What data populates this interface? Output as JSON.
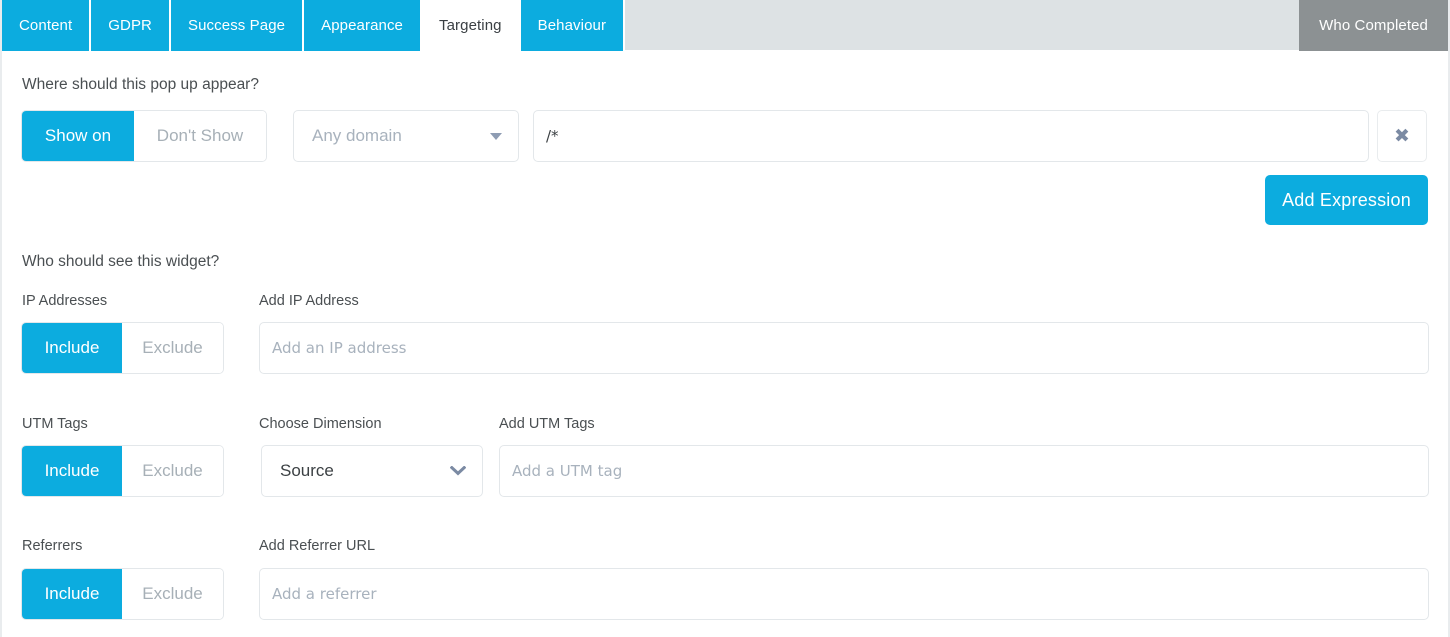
{
  "tabs": [
    {
      "label": "Content",
      "active": false
    },
    {
      "label": "GDPR",
      "active": false
    },
    {
      "label": "Success Page",
      "active": false
    },
    {
      "label": "Appearance",
      "active": false
    },
    {
      "label": "Targeting",
      "active": true
    },
    {
      "label": "Behaviour",
      "active": false
    }
  ],
  "right_tab": {
    "label": "Who Completed"
  },
  "sections": {
    "where_heading": "Where should this pop up appear?",
    "who_heading": "Who should see this widget?"
  },
  "domain_rule": {
    "show_toggle": {
      "on_label": "Show on",
      "off_label": "Don't Show",
      "selected": "Show on"
    },
    "domain_select": {
      "value": "Any domain",
      "caret": "caret-down-icon"
    },
    "pattern_input": {
      "value": "/*",
      "placeholder": ""
    },
    "remove_button": {
      "glyph": "✖",
      "icon": "close-icon"
    },
    "add_expression_button": {
      "label": "Add Expression"
    }
  },
  "ip": {
    "label": "IP Addresses",
    "input_label": "Add IP Address",
    "toggle": {
      "include_label": "Include",
      "exclude_label": "Exclude",
      "selected": "Include"
    },
    "input": {
      "value": "",
      "placeholder": "Add an IP address"
    }
  },
  "utm": {
    "label": "UTM Tags",
    "dimension_label": "Choose Dimension",
    "input_label": "Add UTM Tags",
    "toggle": {
      "include_label": "Include",
      "exclude_label": "Exclude",
      "selected": "Include"
    },
    "dimension_select": {
      "value": "Source",
      "caret": "chevron-down-icon"
    },
    "input": {
      "value": "",
      "placeholder": "Add a UTM tag"
    }
  },
  "referrers": {
    "label": "Referrers",
    "input_label": "Add Referrer URL",
    "toggle": {
      "include_label": "Include",
      "exclude_label": "Exclude",
      "selected": "Include"
    },
    "input": {
      "value": "",
      "placeholder": "Add a referrer"
    }
  },
  "colors": {
    "accent": "#0cacdf",
    "tabbar_bg": "#dde2e4",
    "right_tab_bg": "#8c9193",
    "border": "#e3e7ea",
    "muted_text": "#a8b2bd",
    "text": "#3c4144"
  }
}
